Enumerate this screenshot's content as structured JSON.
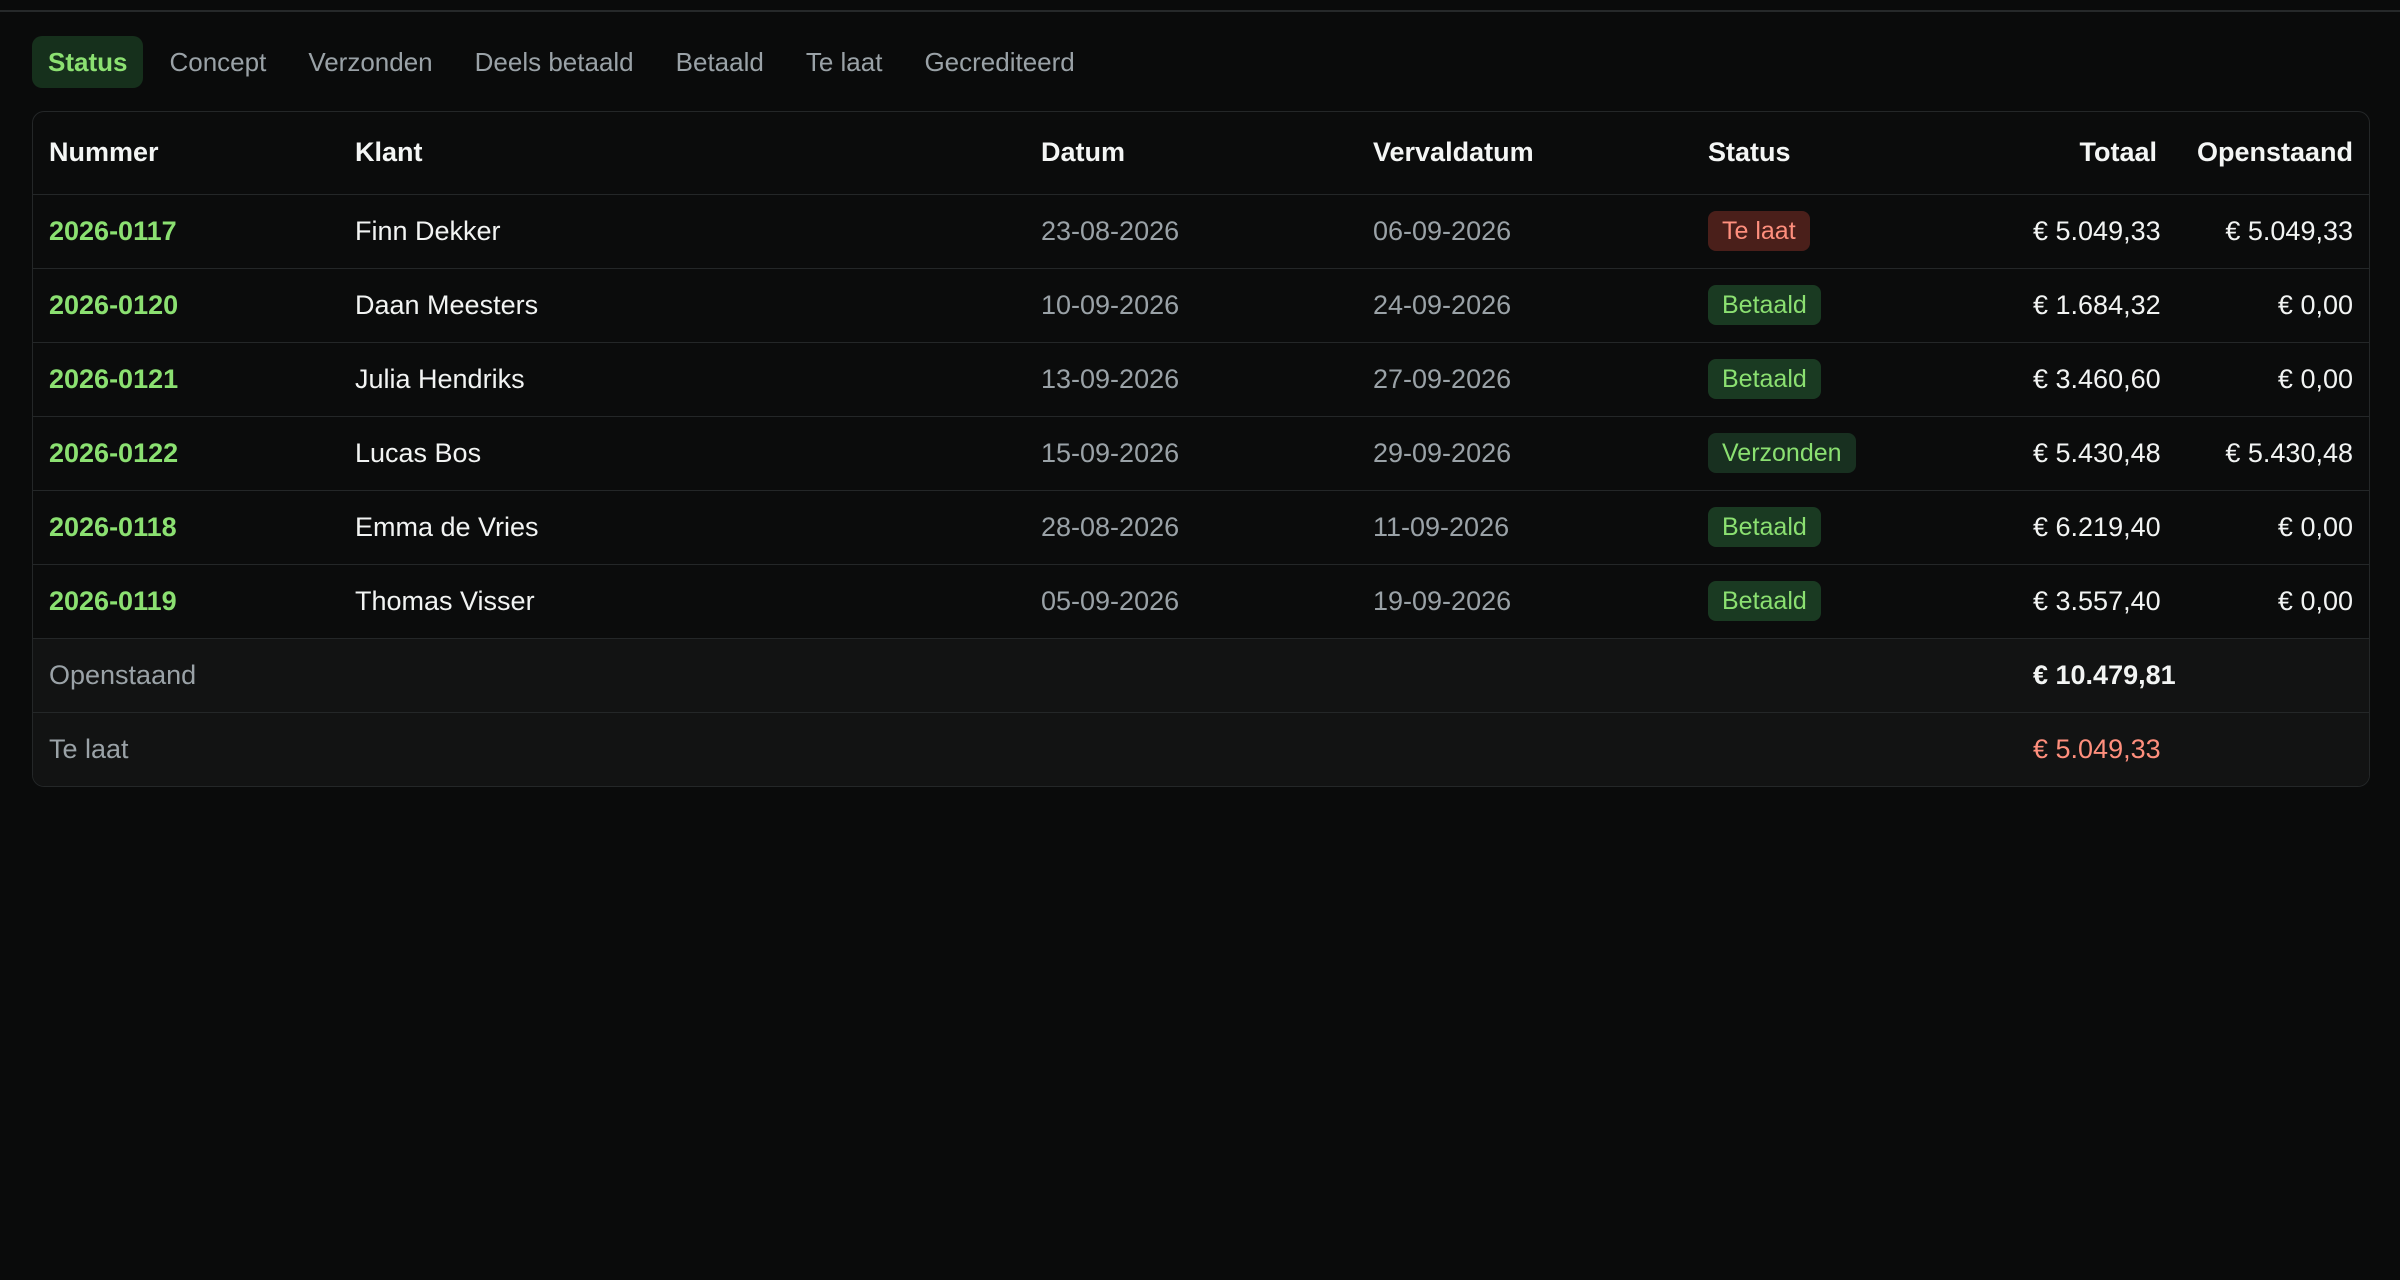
{
  "tabs": [
    "Status",
    "Concept",
    "Verzonden",
    "Deels betaald",
    "Betaald",
    "Te laat",
    "Gecrediteerd"
  ],
  "active_tab": "Status",
  "table": {
    "headers": {
      "nummer": "Nummer",
      "klant": "Klant",
      "datum": "Datum",
      "vervaldatum": "Vervaldatum",
      "status": "Status",
      "totaal": "Totaal",
      "openstaand": "Openstaand"
    },
    "rows": [
      {
        "nummer": "2026-0117",
        "klant": "Finn Dekker",
        "datum": "23-08-2026",
        "vervaldatum": "06-09-2026",
        "status": "Te laat",
        "status_kind": "late",
        "totaal": "€ 5.049,33",
        "openstaand": "€ 5.049,33"
      },
      {
        "nummer": "2026-0120",
        "klant": "Daan Meesters",
        "datum": "10-09-2026",
        "vervaldatum": "24-09-2026",
        "status": "Betaald",
        "status_kind": "paid",
        "totaal": "€ 1.684,32",
        "openstaand": "€ 0,00"
      },
      {
        "nummer": "2026-0121",
        "klant": "Julia Hendriks",
        "datum": "13-09-2026",
        "vervaldatum": "27-09-2026",
        "status": "Betaald",
        "status_kind": "paid",
        "totaal": "€ 3.460,60",
        "openstaand": "€ 0,00"
      },
      {
        "nummer": "2026-0122",
        "klant": "Lucas Bos",
        "datum": "15-09-2026",
        "vervaldatum": "29-09-2026",
        "status": "Verzonden",
        "status_kind": "sent",
        "totaal": "€ 5.430,48",
        "openstaand": "€ 5.430,48"
      },
      {
        "nummer": "2026-0118",
        "klant": "Emma de Vries",
        "datum": "28-08-2026",
        "vervaldatum": "11-09-2026",
        "status": "Betaald",
        "status_kind": "paid",
        "totaal": "€ 6.219,40",
        "openstaand": "€ 0,00"
      },
      {
        "nummer": "2026-0119",
        "klant": "Thomas Visser",
        "datum": "05-09-2026",
        "vervaldatum": "19-09-2026",
        "status": "Betaald",
        "status_kind": "paid",
        "totaal": "€ 3.557,40",
        "openstaand": "€ 0,00"
      }
    ],
    "summary": {
      "openstaand_label": "Openstaand",
      "openstaand_value": "€ 10.479,81",
      "te_laat_label": "Te laat",
      "te_laat_value": "€ 5.049,33"
    }
  },
  "colors": {
    "accent_green": "#8be071",
    "late_red": "#ff8f7d",
    "background": "#0a0b0b"
  }
}
